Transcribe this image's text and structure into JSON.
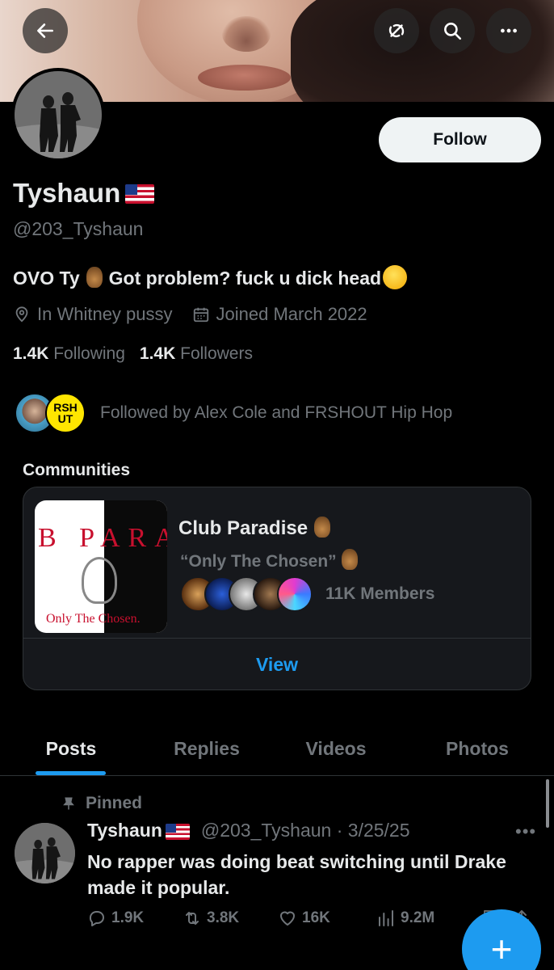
{
  "header": {
    "back_icon": "arrow-left-icon",
    "grok_icon": "grok-icon",
    "search_icon": "search-icon",
    "more_icon": "more-dots-icon"
  },
  "profile": {
    "follow_label": "Follow",
    "name": "Tyshaun",
    "handle": "@203_Tyshaun",
    "bio_part1": "OVO Ty",
    "bio_part2": "Got problem? fuck u dick head",
    "location": "In Whitney pussy",
    "joined": "Joined March 2022",
    "following_count": "1.4K",
    "following_label": "Following",
    "followers_count": "1.4K",
    "followers_label": "Followers",
    "followed_by": "Followed by Alex Cole and FRSHOUT Hip Hop",
    "fav2_text": "RSH UT"
  },
  "communities": {
    "title": "Communities",
    "card": {
      "cover_text": "B PARA",
      "cover_tag": "Only The Chosen.",
      "name": "Club Paradise",
      "subtitle": "“Only The Chosen”",
      "members": "11K Members",
      "view_label": "View"
    }
  },
  "tabs": [
    "Posts",
    "Replies",
    "Videos",
    "Photos"
  ],
  "post": {
    "pinned_label": "Pinned",
    "author": "Tyshaun",
    "meta": "@203_Tyshaun · 3/25/25",
    "text": "No rapper was doing beat switching until Drake made it popular.",
    "replies": "1.9K",
    "reposts": "3.8K",
    "likes": "16K",
    "views": "9.2M"
  },
  "colors": {
    "accent": "#1d9bf0",
    "background": "#000000",
    "muted_text": "#71767b",
    "text": "#e7e9ea"
  }
}
